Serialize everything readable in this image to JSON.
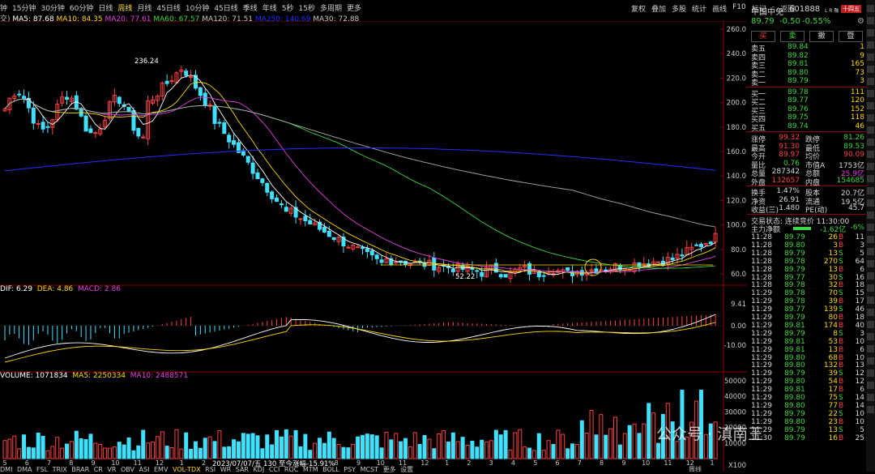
{
  "toolbar": {
    "periods": [
      "钟",
      "15分钟",
      "30分钟",
      "60分钟",
      "日线",
      "周线",
      "月线",
      "45日线",
      "10分钟",
      "45日线",
      "季线",
      "年线",
      "5秒",
      "15秒",
      "多周期",
      "更多"
    ],
    "active_index": 5,
    "right": [
      "复权",
      "叠加",
      "多股",
      "统计",
      "画线",
      "F10",
      "标记",
      "-",
      "返回"
    ]
  },
  "ma_legend": {
    "prefix": "交)",
    "items": [
      {
        "text": "MA5: 87.68",
        "color": "#ffffff"
      },
      {
        "text": "MA10: 84.35",
        "color": "#ffd800"
      },
      {
        "text": "MA20: 77.61",
        "color": "#e040e0"
      },
      {
        "text": "MA60: 67.57",
        "color": "#3ed63e"
      },
      {
        "text": "MA120: 71.51",
        "color": "#c8c8c8"
      },
      {
        "text": "MA250: 140.69",
        "color": "#2030ff"
      },
      {
        "text": "MA30: 72.88",
        "color": "#c8c8c8"
      }
    ]
  },
  "price_axis": [
    "260.0",
    "240.0",
    "220.0",
    "200.0",
    "180.0",
    "160.0",
    "140.0",
    "120.0",
    "100.0",
    "80.0",
    "60.0"
  ],
  "annotations": {
    "high": "236.24",
    "low": "52.22"
  },
  "macd_legend": {
    "dif": "DIF: 6.29",
    "dea": "DEA: 4.86",
    "macd": "MACD: 2.86"
  },
  "macd_axis": {
    "top": "9.41",
    "mid": "0.00",
    "low": "-10.00"
  },
  "vol_legend": {
    "vol": "VOLUME: 1071834",
    "ma5": "MA5: 2250334",
    "ma10": "MA10: 2488571"
  },
  "vol_axis": [
    "50000",
    "40000",
    "30000",
    "20000",
    "10000",
    "X100"
  ],
  "x_ticks": [
    "5",
    "6",
    "7",
    "8",
    "9",
    "10",
    "11",
    "12",
    "1",
    "2",
    "3",
    "4",
    "5",
    "6",
    "7",
    "8",
    "9",
    "10",
    "11",
    "12",
    "1",
    "2",
    "3",
    "4",
    "5",
    "6",
    "7",
    "8",
    "9",
    "10",
    "11",
    "12",
    "1"
  ],
  "x_tooltip": "2023/07/07/五 130 至今涨幅-15.91%",
  "bottom_tabs": [
    "DMI",
    "DMA",
    "FSL",
    "TRIX",
    "BRAR",
    "CR",
    "VR",
    "OBV",
    "ASI",
    "EMV",
    "VOL-TDX",
    "RSI",
    "WR",
    "SAR",
    "KDJ",
    "CCI",
    "ROC",
    "MTM",
    "BOLL",
    "PSY",
    "MCST",
    "更多",
    "设置"
  ],
  "bottom_period": "周线",
  "quote": {
    "name": "中国中免",
    "code": "601888",
    "badge": "L R 融",
    "price": "89.79",
    "change": "-0.50",
    "pct": "-0.55%",
    "tag": "十四五",
    "buttons": [
      "买",
      "卖",
      "撤",
      "暨"
    ],
    "asks": [
      {
        "label": "卖五",
        "price": "89.84",
        "vol": "1"
      },
      {
        "label": "卖四",
        "price": "89.82",
        "vol": "9"
      },
      {
        "label": "卖三",
        "price": "89.81",
        "vol": "165"
      },
      {
        "label": "卖二",
        "price": "89.80",
        "vol": "73"
      },
      {
        "label": "卖一",
        "price": "89.79",
        "vol": "3"
      }
    ],
    "bids": [
      {
        "label": "买一",
        "price": "89.78",
        "vol": "111"
      },
      {
        "label": "买二",
        "price": "89.77",
        "vol": "120"
      },
      {
        "label": "买三",
        "price": "89.76",
        "vol": "152"
      },
      {
        "label": "买四",
        "price": "89.75",
        "vol": "118"
      },
      {
        "label": "买五",
        "price": "89.74",
        "vol": "46"
      }
    ],
    "stats": [
      {
        "l1": "涨停",
        "v1": "99.32",
        "c1": "red",
        "l2": "跌停",
        "v2": "81.26",
        "c2": "green"
      },
      {
        "l1": "最高",
        "v1": "91.30",
        "c1": "red",
        "l2": "最低",
        "v2": "89.53",
        "c2": "green"
      },
      {
        "l1": "今开",
        "v1": "89.97",
        "c1": "red",
        "l2": "均价",
        "v2": "90.09",
        "c2": "red"
      },
      {
        "l1": "量比",
        "v1": "0.76",
        "c1": "green",
        "l2": "市值A",
        "v2": "1753亿",
        "c2": "white"
      },
      {
        "l1": "总量",
        "v1": "287342",
        "c1": "white",
        "l2": "总额",
        "v2": "25.9亿",
        "c2": "magenta"
      },
      {
        "l1": "外盘",
        "v1": "132657",
        "c1": "red",
        "l2": "内盘",
        "v2": "154685",
        "c2": "green"
      }
    ],
    "stats2": [
      {
        "l1": "换手",
        "v1": "1.47%",
        "l2": "股本",
        "v2": "20.7亿"
      },
      {
        "l1": "净资",
        "v1": "26.91",
        "l2": "流通",
        "v2": "19.5亿"
      },
      {
        "l1": "收益(三)",
        "v1": "1.480",
        "l2": "PE(动)",
        "v2": "45.7"
      }
    ],
    "trade_status": "交易状态: 连续竞价 11:30:00",
    "net_flow_label": "主力净额",
    "net_flow": "-1.62亿",
    "net_flow_pct": "-6%",
    "ticks": [
      [
        "11:28",
        "89.79",
        "26",
        "B",
        "11"
      ],
      [
        "11:28",
        "89.80",
        "3",
        "B",
        "3"
      ],
      [
        "11:28",
        "89.79",
        "13",
        "S",
        "5"
      ],
      [
        "11:28",
        "89.78",
        "270",
        "S",
        "64"
      ],
      [
        "11:28",
        "89.79",
        "13",
        "B",
        "6"
      ],
      [
        "11:28",
        "89.77",
        "30",
        "S",
        "16"
      ],
      [
        "11:28",
        "89.78",
        "32",
        "B",
        "18"
      ],
      [
        "11:29",
        "89.78",
        "70",
        "S",
        "15"
      ],
      [
        "11:29",
        "89.78",
        "39",
        "B",
        "17"
      ],
      [
        "11:29",
        "89.77",
        "139",
        "S",
        "46"
      ],
      [
        "11:29",
        "89.79",
        "80",
        "B",
        "18"
      ],
      [
        "11:29",
        "89.81",
        "174",
        "B",
        "40"
      ],
      [
        "11:29",
        "89.79",
        "8",
        "S",
        "3"
      ],
      [
        "11:29",
        "89.81",
        "53",
        "B",
        "10"
      ],
      [
        "11:29",
        "89.81",
        "13",
        "B",
        "6"
      ],
      [
        "11:29",
        "89.80",
        "68",
        "B",
        "10"
      ],
      [
        "11:29",
        "89.80",
        "132",
        "B",
        "13"
      ],
      [
        "11:29",
        "89.79",
        "39",
        "S",
        "12"
      ],
      [
        "11:29",
        "89.80",
        "54",
        "B",
        "12"
      ],
      [
        "11:29",
        "89.81",
        "17",
        "B",
        "6"
      ],
      [
        "11:29",
        "89.80",
        "75",
        "S",
        "14"
      ],
      [
        "11:29",
        "89.80",
        "77",
        "B",
        "14"
      ],
      [
        "11:29",
        "89.79",
        "22",
        "S",
        "10"
      ],
      [
        "11:29",
        "89.80",
        "23",
        "B",
        "10"
      ],
      [
        "11:29",
        "89.79",
        "13",
        "S",
        "5"
      ],
      [
        "11:30",
        "89.79",
        "16",
        "B",
        "25"
      ]
    ]
  },
  "watermark": "公众号 · 滇南王",
  "colors": {
    "up": "#ff4040",
    "down": "#40e0ff",
    "bg": "#000000",
    "border": "#8b0000"
  }
}
